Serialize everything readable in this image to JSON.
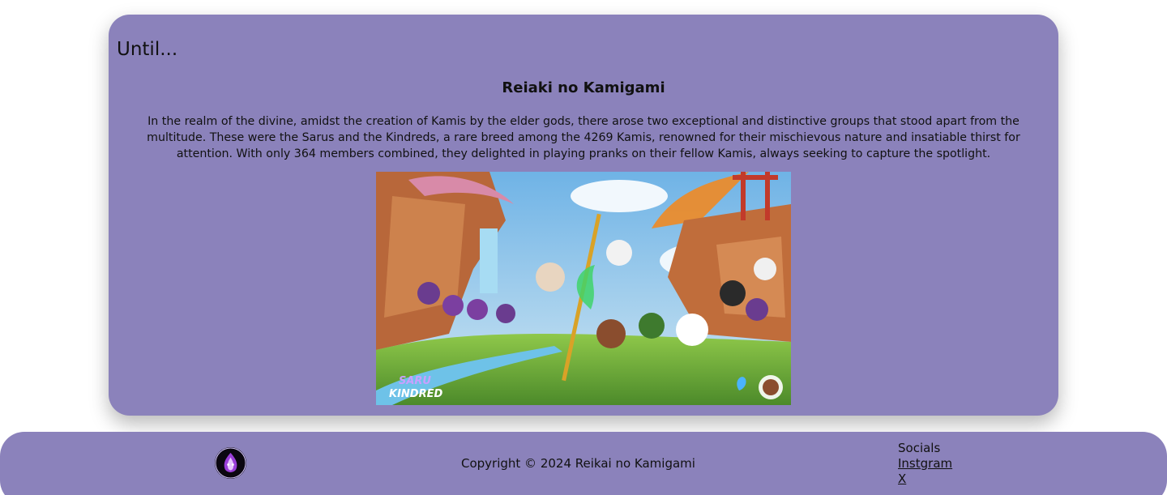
{
  "main": {
    "heading": "Until...",
    "title": "Reiaki no Kamigami",
    "description": "In the realm of the divine, amidst the creation of Kamis by the elder gods, there arose two exceptional and distinctive groups that stood apart from the multitude. These were the Sarus and the Kindreds, a rare breed among the 4269 Kamis, renowned for their mischievous nature and insatiable thirst for attention. With only 364 members combined, they delighted in playing pranks on their fellow Kamis, always seeking to capture the spotlight.",
    "artwork": {
      "logo_text_top": "SARU",
      "logo_text_bottom": "KINDRED"
    }
  },
  "footer": {
    "copyright": "Copyright © 2024 Reikai no Kamigami",
    "socials_title": "Socials",
    "links": [
      "Instgram",
      "X"
    ]
  },
  "colors": {
    "card_bg": "#8b82bb",
    "page_bg": "#ffffff"
  }
}
